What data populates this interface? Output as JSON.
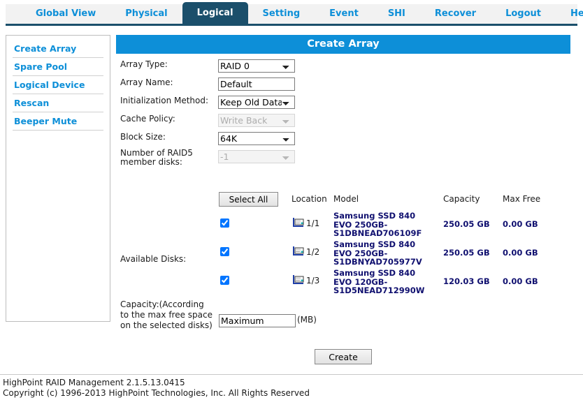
{
  "nav": {
    "tabs": [
      {
        "label": "Global View",
        "active": false
      },
      {
        "label": "Physical",
        "active": false
      },
      {
        "label": "Logical",
        "active": true
      },
      {
        "label": "Setting",
        "active": false
      },
      {
        "label": "Event",
        "active": false
      },
      {
        "label": "SHI",
        "active": false
      },
      {
        "label": "Recover",
        "active": false
      },
      {
        "label": "Logout",
        "active": false
      },
      {
        "label": "Help",
        "active": false
      }
    ]
  },
  "sidebar": {
    "items": [
      {
        "label": "Create Array"
      },
      {
        "label": "Spare Pool"
      },
      {
        "label": "Logical Device"
      },
      {
        "label": "Rescan"
      },
      {
        "label": "Beeper Mute"
      }
    ]
  },
  "panel": {
    "title": "Create Array"
  },
  "form": {
    "array_type": {
      "label": "Array Type:",
      "value": "RAID 0",
      "disabled": false
    },
    "array_name": {
      "label": "Array Name:",
      "value": "Default",
      "placeholder": ""
    },
    "init_method": {
      "label": "Initialization Method:",
      "value": "Keep Old Data",
      "disabled": false
    },
    "cache_policy": {
      "label": "Cache Policy:",
      "value": "Write Back",
      "disabled": true
    },
    "block_size": {
      "label": "Block Size:",
      "value": "64K",
      "disabled": false
    },
    "raid5_disks": {
      "label_line1": "Number of RAID5",
      "label_line2": "member disks:",
      "value": "-1",
      "disabled": true
    }
  },
  "disks": {
    "label": "Available Disks:",
    "select_all_label": "Select All",
    "columns": {
      "location": "Location",
      "model": "Model",
      "capacity": "Capacity",
      "max_free": "Max Free"
    },
    "rows": [
      {
        "checked": true,
        "location": "1/1",
        "model": "Samsung SSD 840 EVO 250GB-S1DBNEAD706109F",
        "capacity": "250.05 GB",
        "max_free": "0.00 GB"
      },
      {
        "checked": true,
        "location": "1/2",
        "model": "Samsung SSD 840 EVO 250GB-S1DBNYAD705977V",
        "capacity": "250.05 GB",
        "max_free": "0.00 GB"
      },
      {
        "checked": true,
        "location": "1/3",
        "model": "Samsung SSD 840 EVO 120GB-S1D5NEAD712990W",
        "capacity": "120.03 GB",
        "max_free": "0.00 GB"
      }
    ]
  },
  "capacity": {
    "label": "Capacity:(According to the max free space on the selected disks)",
    "value": "Maximum",
    "unit": "(MB)"
  },
  "actions": {
    "create_label": "Create"
  },
  "footer": {
    "line1": "HighPoint RAID Management 2.1.5.13.0415",
    "line2": "Copyright (c) 1996-2013 HighPoint Technologies, Inc. All Rights Reserved"
  },
  "colors": {
    "accent_blue": "#0d8fd8",
    "active_tab": "#1b4f6b",
    "disk_text": "#111170"
  }
}
